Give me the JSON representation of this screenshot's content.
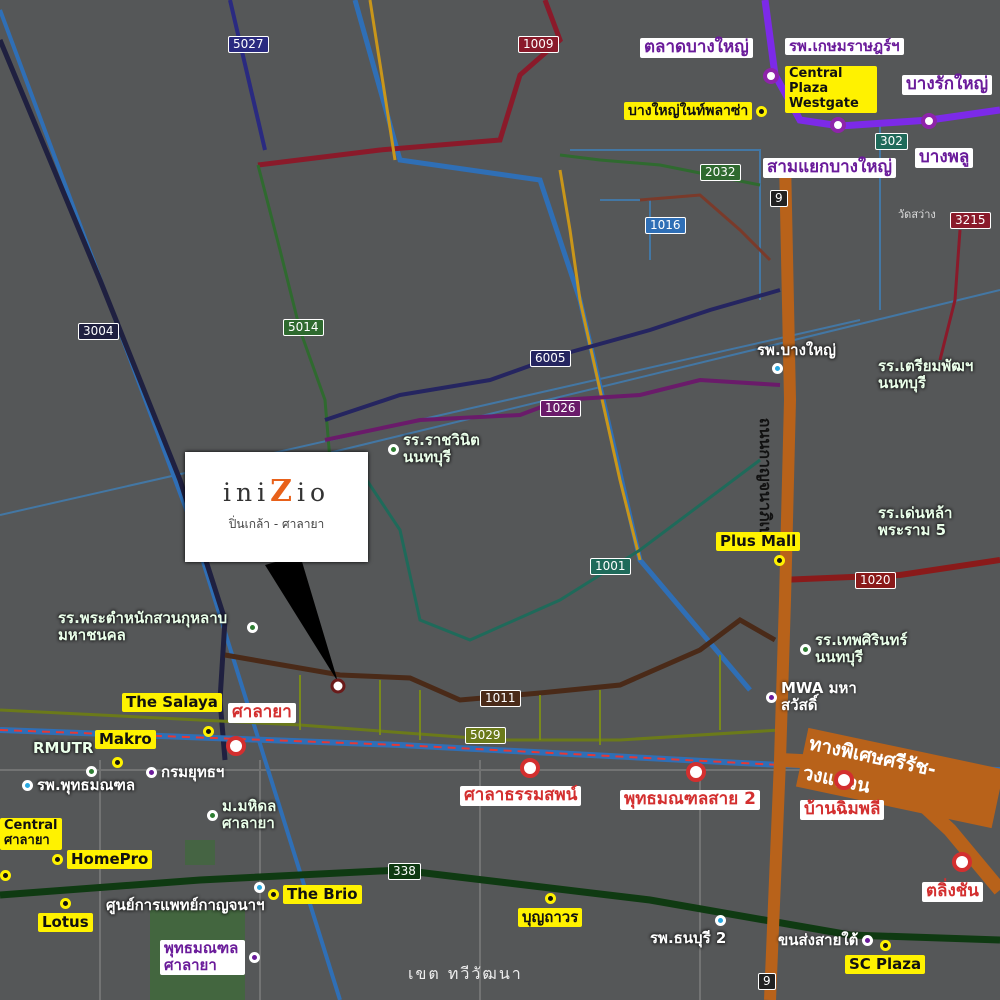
{
  "project": {
    "brand_prefix": "ini",
    "brand_z": "Z",
    "brand_suffix": "io",
    "subtitle": "ปิ่นเกล้า - ศาลายา"
  },
  "route_numbers": {
    "r5027": "5027",
    "r1009": "1009",
    "r2032": "2032",
    "r1016": "1016",
    "r302": "302",
    "r9_top": "9",
    "r3215": "3215",
    "r3004": "3004",
    "r5014": "5014",
    "r6005": "6005",
    "r1026": "1026",
    "r1001": "1001",
    "r1020": "1020",
    "r1011": "1011",
    "r5029": "5029",
    "r338": "338",
    "r9_bottom": "9"
  },
  "road_names": {
    "kanchana": "ถนนกาญจนาภิเษก",
    "expressway": "ทางพิเศษศรีรัช-วงแหวน",
    "district": "เขต ทวีวัฒนา"
  },
  "poi": {
    "talat_bangyai": "ตลาดบางใหญ่",
    "kasemrad": "รพ.เกษมราษฎร์ฯ",
    "central_westgate": "Central Plaza Westgate",
    "bangrak_yai": "บางรักใหญ่",
    "bangyai_intersection": "บางใหญ่ในท์พลาซ่า",
    "samyaek_bangyai": "สามแยกบางใหญ่",
    "bangphlu": "บางพลู",
    "bangyai_hospital": "รพ.บางใหญ่",
    "triam_nonthaburi": "รร.เตรียมพัฒฯ นนทบุรี",
    "rachawinit": "รร.ราชวินิต นนทบุรี",
    "denla": "รร.เด่นหล้า พระราม 5",
    "plus_mall": "Plus Mall",
    "phra_tamnak": "รร.พระตำหนักสวนกุหลาบ มหาชนคล",
    "thepsirin": "รร.เทพศิรินทร์ นนทบุรี",
    "mwa": "MWA มหาสวัสดิ์",
    "the_salaya": "The Salaya",
    "salaya_station": "ศาลายา",
    "makro": "Makro",
    "rmutr": "RMUTR",
    "kromyut": "กรมยุทธฯ",
    "phutthamonthon_hospital": "รพ.พุทธมณฑล",
    "mahidol": "ม.มหิดล ศาลายา",
    "central_salaya": "Central ศาลายา",
    "homepro": "HomePro",
    "lotus": "Lotus",
    "the_brio": "The Brio",
    "kanchana_center": "ศูนย์การแพทย์กาญจนาฯ",
    "phutthamonthon_salaya": "พุทธมณฑล ศาลายา",
    "bunthawon": "บุญถาวร",
    "thonburi2": "รพ.ธนบุรี 2",
    "khonsong": "ขนส่งสายใต้",
    "sc_plaza": "SC Plaza",
    "sala_thammasop": "ศาลาธรรมสพน์",
    "phutthamonthon_sai2": "พุทธมณฑลสาย 2",
    "ban_chimphli": "บ้านฉิมพลี",
    "taling_chan": "ตลิ่งชัน",
    "wat_sawang": "วัดสว่าง"
  }
}
